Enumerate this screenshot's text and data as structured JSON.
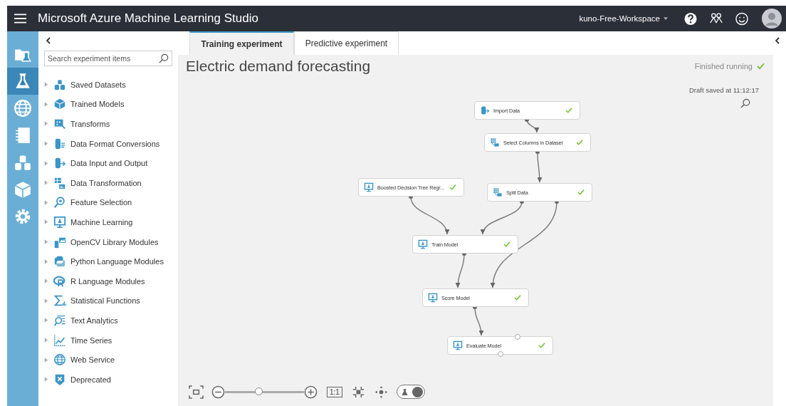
{
  "header": {
    "title": "Microsoft Azure Machine Learning Studio",
    "workspace": "kuno-Free-Workspace"
  },
  "nav": [
    {
      "selected": false
    },
    {
      "selected": true
    },
    {
      "selected": false
    },
    {
      "selected": false
    },
    {
      "selected": false
    },
    {
      "selected": false
    },
    {
      "selected": false
    }
  ],
  "palette": {
    "search": {
      "placeholder": "Search experiment items"
    },
    "items": [
      {
        "label": "Saved Datasets",
        "expanded": false
      },
      {
        "label": "Trained Models",
        "expanded": false
      },
      {
        "label": "Transforms",
        "expanded": false
      },
      {
        "label": "Data Format Conversions",
        "expanded": false
      },
      {
        "label": "Data Input and Output",
        "expanded": false
      },
      {
        "label": "Data Transformation",
        "expanded": false
      },
      {
        "label": "Feature Selection",
        "expanded": false
      },
      {
        "label": "Machine Learning",
        "expanded": false
      },
      {
        "label": "OpenCV Library Modules",
        "expanded": false
      },
      {
        "label": "Python Language Modules",
        "expanded": false
      },
      {
        "label": "R Language Modules",
        "expanded": false
      },
      {
        "label": "Statistical Functions",
        "expanded": false
      },
      {
        "label": "Text Analytics",
        "expanded": false
      },
      {
        "label": "Time Series",
        "expanded": false
      },
      {
        "label": "Web Service",
        "expanded": false
      },
      {
        "label": "Deprecated",
        "expanded": false
      }
    ]
  },
  "tabs": [
    {
      "label": "Training experiment",
      "selected": true
    },
    {
      "label": "Predictive experiment",
      "selected": false
    }
  ],
  "experiment": {
    "title": "Electric demand forecasting",
    "status": "Finished running",
    "succeeded": true,
    "draft_saved": "Draft saved at 11:12:17"
  },
  "nodes": [
    {
      "label": "Import Data",
      "finished": true,
      "open_ports": false
    },
    {
      "label": "Select Columns in Dataset",
      "finished": true,
      "open_ports": false
    },
    {
      "label": "Boosted Decision Tree Regr...",
      "finished": true,
      "open_ports": false
    },
    {
      "label": "Split Data",
      "finished": true,
      "open_ports": false
    },
    {
      "label": "Train Model",
      "finished": true,
      "open_ports": false
    },
    {
      "label": "Score Model",
      "finished": true,
      "open_ports": false
    },
    {
      "label": "Evaluate Model",
      "finished": true,
      "open_ports": true
    }
  ],
  "toolbar": {
    "zoom": {
      "level": 0.43
    },
    "actual_size": "1:1",
    "toggle_on": true
  }
}
